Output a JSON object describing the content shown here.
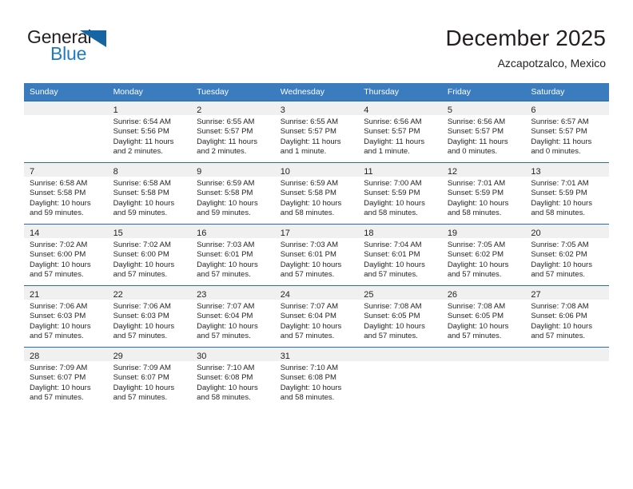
{
  "brand": {
    "word_one": "General",
    "word_two": "Blue",
    "triangle_color": "#1565a5",
    "blue_text_color": "#1f7bc1"
  },
  "header": {
    "title": "December 2025",
    "subtitle": "Azcapotzalco, Mexico",
    "header_bg": "#3a7cbe",
    "band_bg": "#f0f0f0"
  },
  "weekday_headers": [
    "Sunday",
    "Monday",
    "Tuesday",
    "Wednesday",
    "Thursday",
    "Friday",
    "Saturday"
  ],
  "weeks": [
    [
      {
        "day": "",
        "lines": []
      },
      {
        "day": "1",
        "lines": [
          "Sunrise: 6:54 AM",
          "Sunset: 5:56 PM",
          "Daylight: 11 hours",
          "and 2 minutes."
        ]
      },
      {
        "day": "2",
        "lines": [
          "Sunrise: 6:55 AM",
          "Sunset: 5:57 PM",
          "Daylight: 11 hours",
          "and 2 minutes."
        ]
      },
      {
        "day": "3",
        "lines": [
          "Sunrise: 6:55 AM",
          "Sunset: 5:57 PM",
          "Daylight: 11 hours",
          "and 1 minute."
        ]
      },
      {
        "day": "4",
        "lines": [
          "Sunrise: 6:56 AM",
          "Sunset: 5:57 PM",
          "Daylight: 11 hours",
          "and 1 minute."
        ]
      },
      {
        "day": "5",
        "lines": [
          "Sunrise: 6:56 AM",
          "Sunset: 5:57 PM",
          "Daylight: 11 hours",
          "and 0 minutes."
        ]
      },
      {
        "day": "6",
        "lines": [
          "Sunrise: 6:57 AM",
          "Sunset: 5:57 PM",
          "Daylight: 11 hours",
          "and 0 minutes."
        ]
      }
    ],
    [
      {
        "day": "7",
        "lines": [
          "Sunrise: 6:58 AM",
          "Sunset: 5:58 PM",
          "Daylight: 10 hours",
          "and 59 minutes."
        ]
      },
      {
        "day": "8",
        "lines": [
          "Sunrise: 6:58 AM",
          "Sunset: 5:58 PM",
          "Daylight: 10 hours",
          "and 59 minutes."
        ]
      },
      {
        "day": "9",
        "lines": [
          "Sunrise: 6:59 AM",
          "Sunset: 5:58 PM",
          "Daylight: 10 hours",
          "and 59 minutes."
        ]
      },
      {
        "day": "10",
        "lines": [
          "Sunrise: 6:59 AM",
          "Sunset: 5:58 PM",
          "Daylight: 10 hours",
          "and 58 minutes."
        ]
      },
      {
        "day": "11",
        "lines": [
          "Sunrise: 7:00 AM",
          "Sunset: 5:59 PM",
          "Daylight: 10 hours",
          "and 58 minutes."
        ]
      },
      {
        "day": "12",
        "lines": [
          "Sunrise: 7:01 AM",
          "Sunset: 5:59 PM",
          "Daylight: 10 hours",
          "and 58 minutes."
        ]
      },
      {
        "day": "13",
        "lines": [
          "Sunrise: 7:01 AM",
          "Sunset: 5:59 PM",
          "Daylight: 10 hours",
          "and 58 minutes."
        ]
      }
    ],
    [
      {
        "day": "14",
        "lines": [
          "Sunrise: 7:02 AM",
          "Sunset: 6:00 PM",
          "Daylight: 10 hours",
          "and 57 minutes."
        ]
      },
      {
        "day": "15",
        "lines": [
          "Sunrise: 7:02 AM",
          "Sunset: 6:00 PM",
          "Daylight: 10 hours",
          "and 57 minutes."
        ]
      },
      {
        "day": "16",
        "lines": [
          "Sunrise: 7:03 AM",
          "Sunset: 6:01 PM",
          "Daylight: 10 hours",
          "and 57 minutes."
        ]
      },
      {
        "day": "17",
        "lines": [
          "Sunrise: 7:03 AM",
          "Sunset: 6:01 PM",
          "Daylight: 10 hours",
          "and 57 minutes."
        ]
      },
      {
        "day": "18",
        "lines": [
          "Sunrise: 7:04 AM",
          "Sunset: 6:01 PM",
          "Daylight: 10 hours",
          "and 57 minutes."
        ]
      },
      {
        "day": "19",
        "lines": [
          "Sunrise: 7:05 AM",
          "Sunset: 6:02 PM",
          "Daylight: 10 hours",
          "and 57 minutes."
        ]
      },
      {
        "day": "20",
        "lines": [
          "Sunrise: 7:05 AM",
          "Sunset: 6:02 PM",
          "Daylight: 10 hours",
          "and 57 minutes."
        ]
      }
    ],
    [
      {
        "day": "21",
        "lines": [
          "Sunrise: 7:06 AM",
          "Sunset: 6:03 PM",
          "Daylight: 10 hours",
          "and 57 minutes."
        ]
      },
      {
        "day": "22",
        "lines": [
          "Sunrise: 7:06 AM",
          "Sunset: 6:03 PM",
          "Daylight: 10 hours",
          "and 57 minutes."
        ]
      },
      {
        "day": "23",
        "lines": [
          "Sunrise: 7:07 AM",
          "Sunset: 6:04 PM",
          "Daylight: 10 hours",
          "and 57 minutes."
        ]
      },
      {
        "day": "24",
        "lines": [
          "Sunrise: 7:07 AM",
          "Sunset: 6:04 PM",
          "Daylight: 10 hours",
          "and 57 minutes."
        ]
      },
      {
        "day": "25",
        "lines": [
          "Sunrise: 7:08 AM",
          "Sunset: 6:05 PM",
          "Daylight: 10 hours",
          "and 57 minutes."
        ]
      },
      {
        "day": "26",
        "lines": [
          "Sunrise: 7:08 AM",
          "Sunset: 6:05 PM",
          "Daylight: 10 hours",
          "and 57 minutes."
        ]
      },
      {
        "day": "27",
        "lines": [
          "Sunrise: 7:08 AM",
          "Sunset: 6:06 PM",
          "Daylight: 10 hours",
          "and 57 minutes."
        ]
      }
    ],
    [
      {
        "day": "28",
        "lines": [
          "Sunrise: 7:09 AM",
          "Sunset: 6:07 PM",
          "Daylight: 10 hours",
          "and 57 minutes."
        ]
      },
      {
        "day": "29",
        "lines": [
          "Sunrise: 7:09 AM",
          "Sunset: 6:07 PM",
          "Daylight: 10 hours",
          "and 57 minutes."
        ]
      },
      {
        "day": "30",
        "lines": [
          "Sunrise: 7:10 AM",
          "Sunset: 6:08 PM",
          "Daylight: 10 hours",
          "and 58 minutes."
        ]
      },
      {
        "day": "31",
        "lines": [
          "Sunrise: 7:10 AM",
          "Sunset: 6:08 PM",
          "Daylight: 10 hours",
          "and 58 minutes."
        ]
      },
      {
        "day": "",
        "lines": []
      },
      {
        "day": "",
        "lines": []
      },
      {
        "day": "",
        "lines": []
      }
    ]
  ]
}
